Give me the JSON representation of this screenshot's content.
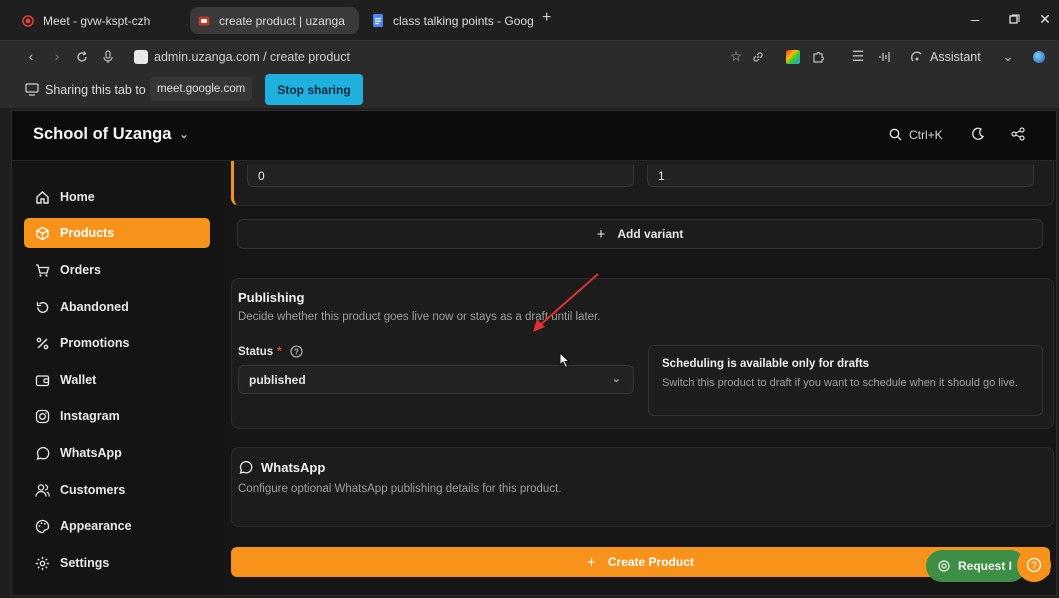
{
  "browser": {
    "tabs": [
      {
        "label": "Meet - gvw-kspt-czh",
        "icon": "meet-record-icon",
        "active": false
      },
      {
        "label": "create product | uzanga",
        "icon": "uzanga-tab-icon",
        "active": true
      },
      {
        "label": "class talking points - Goog",
        "icon": "docs-icon",
        "active": false
      }
    ],
    "new_tab": "+",
    "url": "admin.uzanga.com / create product",
    "assistant_label": "Assistant",
    "sharing_text": "Sharing this tab to",
    "sharing_target": "meet.google.com",
    "stop_sharing_label": "Stop sharing"
  },
  "app": {
    "org_name": "School of Uzanga",
    "search_shortcut": "Ctrl+K",
    "sidebar": {
      "items": [
        {
          "label": "Home",
          "icon": "home-icon"
        },
        {
          "label": "Products",
          "icon": "box-icon",
          "active": true
        },
        {
          "label": "Orders",
          "icon": "cart-icon"
        },
        {
          "label": "Abandoned",
          "icon": "undo-icon"
        },
        {
          "label": "Promotions",
          "icon": "percent-icon"
        },
        {
          "label": "Wallet",
          "icon": "wallet-icon"
        },
        {
          "label": "Instagram",
          "icon": "instagram-icon"
        },
        {
          "label": "WhatsApp",
          "icon": "whatsapp-icon"
        },
        {
          "label": "Customers",
          "icon": "users-icon"
        },
        {
          "label": "Appearance",
          "icon": "palette-icon"
        },
        {
          "label": "Settings",
          "icon": "gear-icon"
        }
      ]
    },
    "variant": {
      "field_a_value": "0",
      "field_b_value": "1",
      "add_variant_label": "Add variant"
    },
    "publishing": {
      "title": "Publishing",
      "description": "Decide whether this product goes live now or stays as a draft until later.",
      "status_label": "Status",
      "required_mark": "*",
      "status_value": "published",
      "scheduling_title": "Scheduling is available only for drafts",
      "scheduling_text": "Switch this product to draft if you want to schedule when it should go live."
    },
    "whatsapp": {
      "title": "WhatsApp",
      "description": "Configure optional WhatsApp publishing details for this product."
    },
    "create_button_label": "Create Product",
    "request_label": "Request I",
    "help_label": "?"
  },
  "colors": {
    "accent": "#f7931a",
    "share_button": "#1fb0e0",
    "annotation_arrow": "#e03030",
    "request_green": "#3d8f45"
  }
}
